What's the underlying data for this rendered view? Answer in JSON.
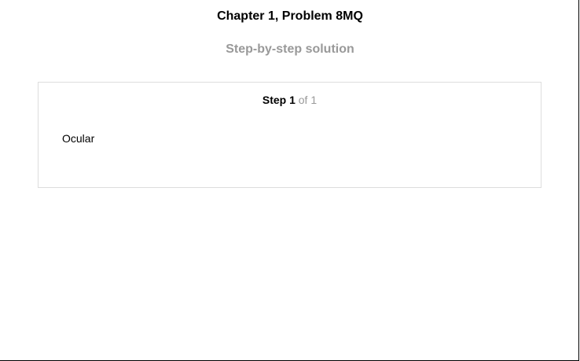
{
  "header": {
    "title": "Chapter 1, Problem 8MQ",
    "subtitle": "Step-by-step solution"
  },
  "step": {
    "label": "Step 1",
    "of_text": "of 1",
    "content": "Ocular"
  },
  "colors": {
    "title": "#000000",
    "subtitle": "#999999",
    "card_border": "#dddddd",
    "muted_text": "#999999"
  }
}
